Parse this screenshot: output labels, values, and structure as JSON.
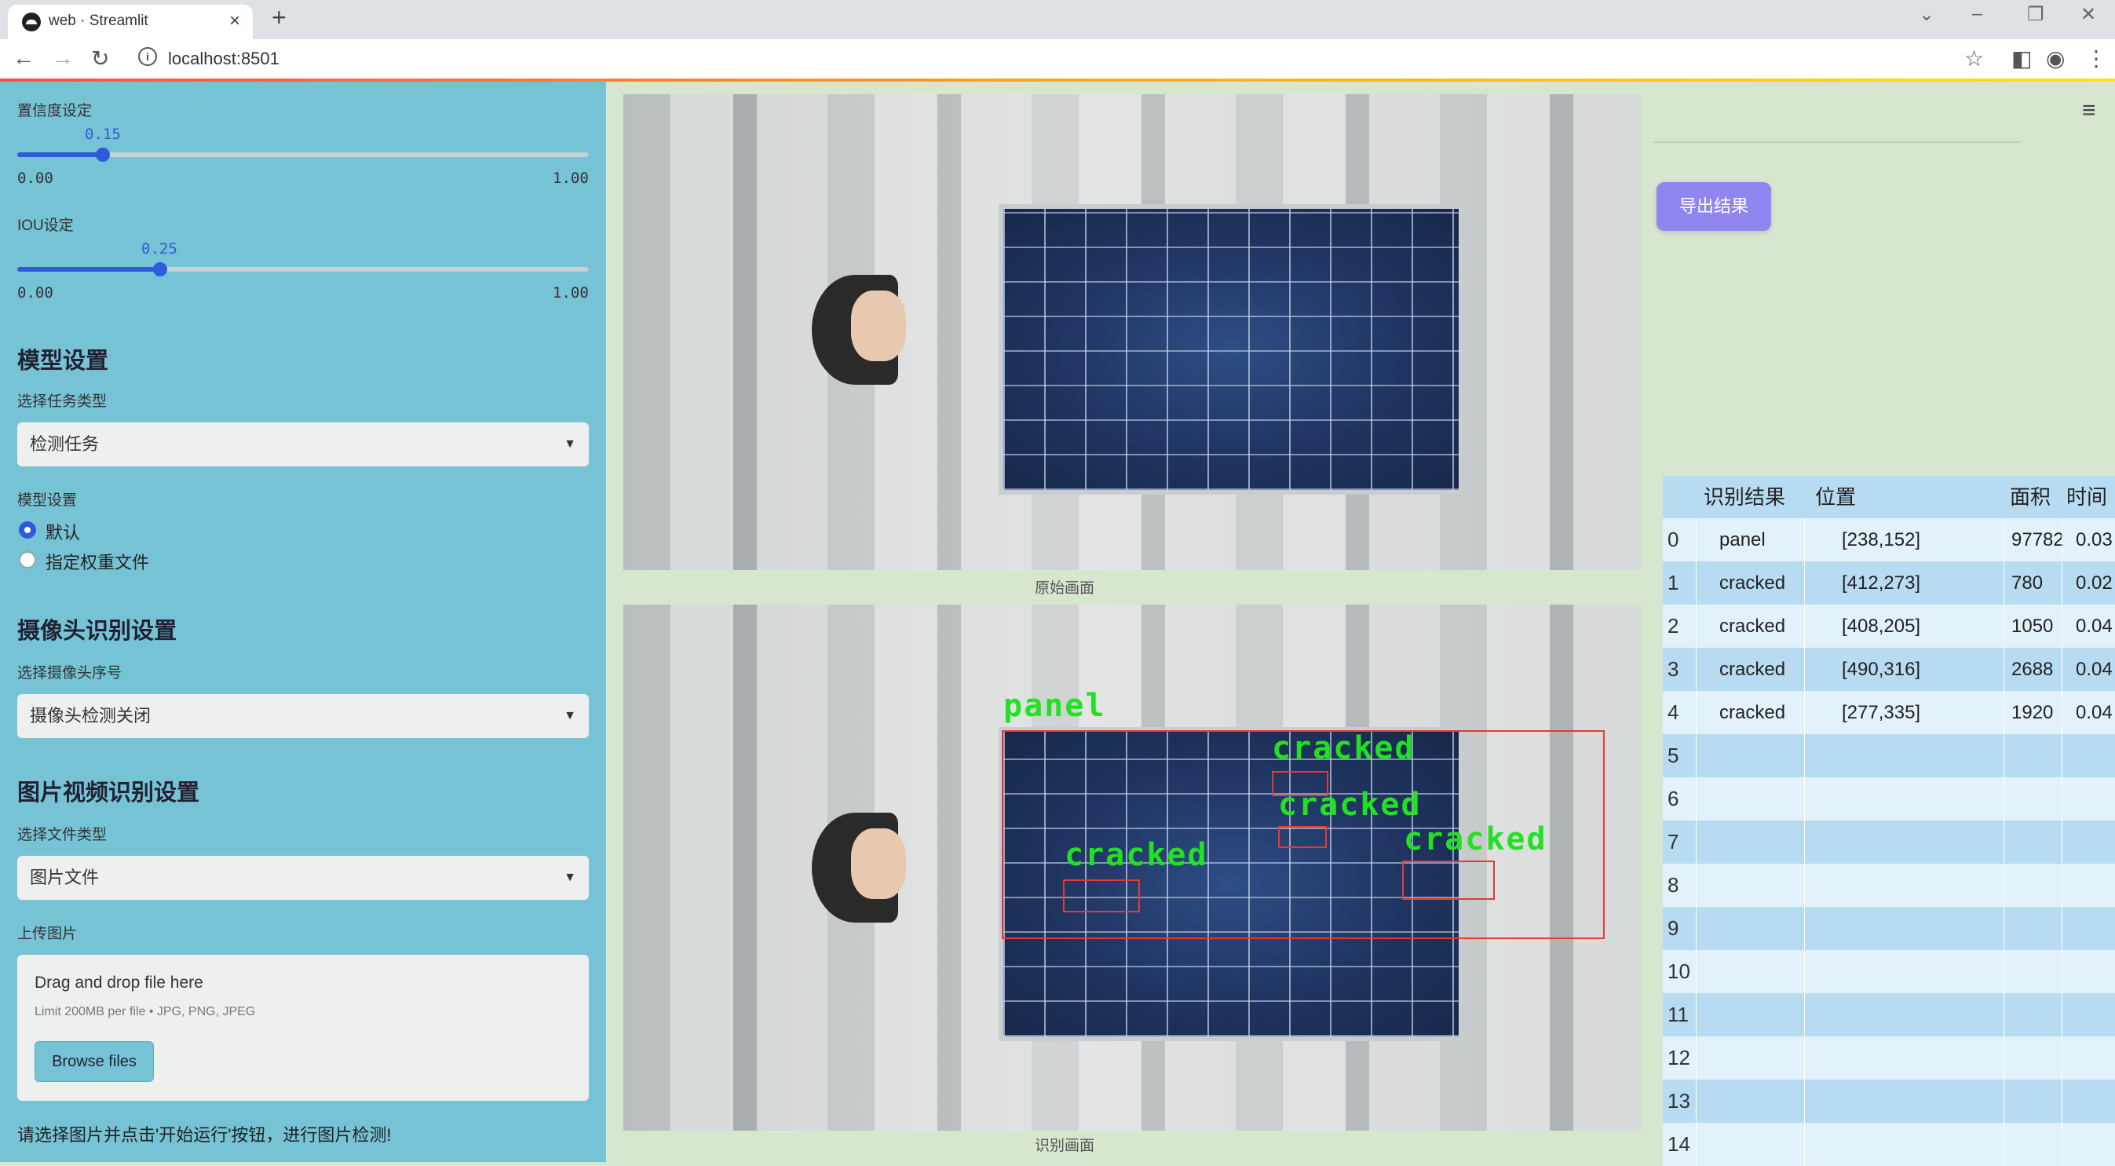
{
  "browser": {
    "tab_title": "web · Streamlit",
    "url": "localhost:8501"
  },
  "sidebar": {
    "confidence": {
      "label": "置信度设定",
      "value": "0.15",
      "min": "0.00",
      "max": "1.00",
      "fraction": 0.15
    },
    "iou": {
      "label": "IOU设定",
      "value": "0.25",
      "min": "0.00",
      "max": "1.00",
      "fraction": 0.25
    },
    "model_heading": "模型设置",
    "task_label": "选择任务类型",
    "task_value": "检测任务",
    "model_sub_label": "模型设置",
    "model_options": [
      "默认",
      "指定权重文件"
    ],
    "model_selected": 0,
    "camera_heading": "摄像头识别设置",
    "camera_label": "选择摄像头序号",
    "camera_value": "摄像头检测关闭",
    "media_heading": "图片视频识别设置",
    "filetype_label": "选择文件类型",
    "filetype_value": "图片文件",
    "upload_label": "上传图片",
    "upload_drop": "Drag and drop file here",
    "upload_limit": "Limit 200MB per file • JPG, PNG, JPEG",
    "browse_button": "Browse files",
    "hint": "请选择图片并点击'开始运行'按钮，进行图片检测!"
  },
  "main": {
    "original_caption": "原始画面",
    "detected_caption": "识别画面",
    "detections": [
      {
        "label": "panel"
      },
      {
        "label": "cracked"
      },
      {
        "label": "cracked"
      },
      {
        "label": "cracked"
      },
      {
        "label": "cracked"
      }
    ]
  },
  "right": {
    "export_button": "导出结果",
    "table": {
      "headers": [
        "识别结果",
        "位置",
        "面积",
        "时间"
      ],
      "rows": [
        {
          "idx": "0",
          "result": "panel",
          "pos": "[238,152]",
          "area": "97782",
          "time": "0.03"
        },
        {
          "idx": "1",
          "result": "cracked",
          "pos": "[412,273]",
          "area": "780",
          "time": "0.02"
        },
        {
          "idx": "2",
          "result": "cracked",
          "pos": "[408,205]",
          "area": "1050",
          "time": "0.04"
        },
        {
          "idx": "3",
          "result": "cracked",
          "pos": "[490,316]",
          "area": "2688",
          "time": "0.04"
        },
        {
          "idx": "4",
          "result": "cracked",
          "pos": "[277,335]",
          "area": "1920",
          "time": "0.04"
        },
        {
          "idx": "5",
          "result": "",
          "pos": "",
          "area": "",
          "time": ""
        },
        {
          "idx": "6",
          "result": "",
          "pos": "",
          "area": "",
          "time": ""
        },
        {
          "idx": "7",
          "result": "",
          "pos": "",
          "area": "",
          "time": ""
        },
        {
          "idx": "8",
          "result": "",
          "pos": "",
          "area": "",
          "time": ""
        },
        {
          "idx": "9",
          "result": "",
          "pos": "",
          "area": "",
          "time": ""
        },
        {
          "idx": "10",
          "result": "",
          "pos": "",
          "area": "",
          "time": ""
        },
        {
          "idx": "11",
          "result": "",
          "pos": "",
          "area": "",
          "time": ""
        },
        {
          "idx": "12",
          "result": "",
          "pos": "",
          "area": "",
          "time": ""
        },
        {
          "idx": "13",
          "result": "",
          "pos": "",
          "area": "",
          "time": ""
        },
        {
          "idx": "14",
          "result": "",
          "pos": "",
          "area": "",
          "time": ""
        }
      ]
    }
  }
}
